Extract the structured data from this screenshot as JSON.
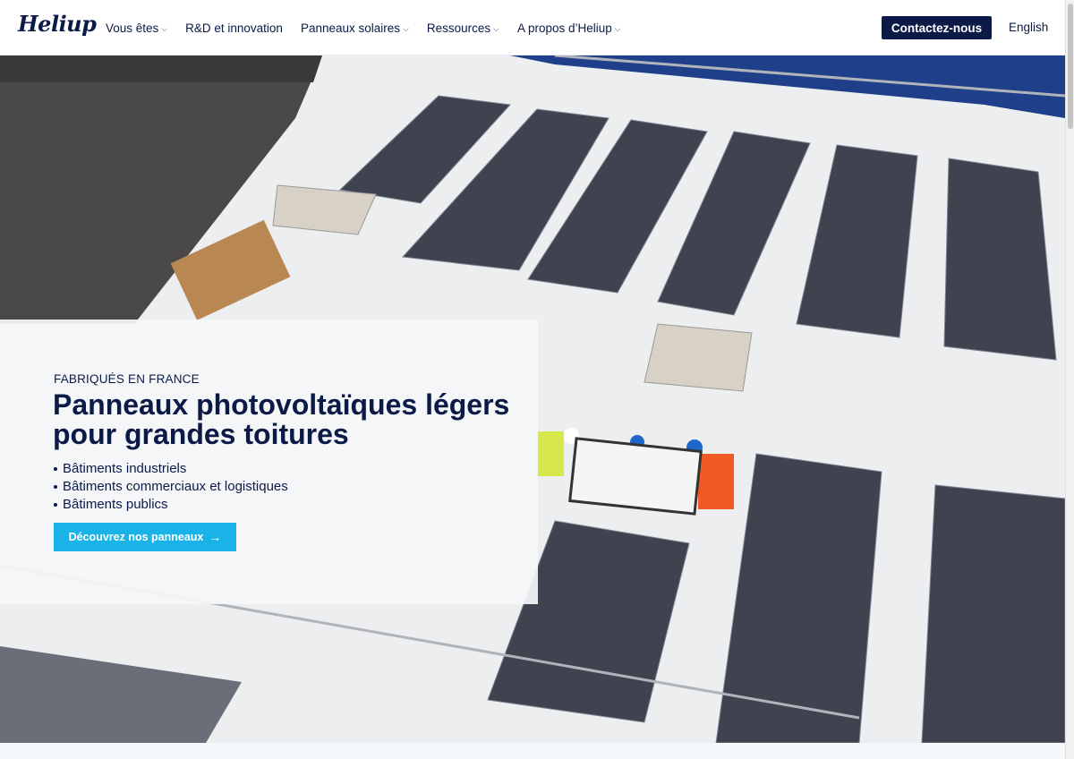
{
  "header": {
    "logo": "Heliup",
    "nav": [
      {
        "label": "Vous êtes",
        "dropdown": true
      },
      {
        "label": "R&D et innovation",
        "dropdown": false
      },
      {
        "label": "Panneaux solaires",
        "dropdown": true
      },
      {
        "label": "Ressources",
        "dropdown": true
      },
      {
        "label": "A propos d’Heliup",
        "dropdown": true
      }
    ],
    "cta_label": "Contactez-nous",
    "language": "English"
  },
  "hero": {
    "eyebrow": "FABRIQUÉS EN FRANCE",
    "title": "Panneaux photovoltaïques légers pour grandes toitures",
    "bullets": [
      "Bâtiments industriels",
      "Bâtiments commerciaux et logistiques",
      "Bâtiments publics"
    ],
    "button_label": "Découvrez nos panneaux",
    "button_icon": "arrow-right-icon",
    "image_description_icon": "rooftop-solar-photo"
  },
  "colors": {
    "navy": "#0c1a48",
    "accent": "#1ab3e8",
    "roof": "#eef0f2",
    "panel": "#3d4250"
  }
}
